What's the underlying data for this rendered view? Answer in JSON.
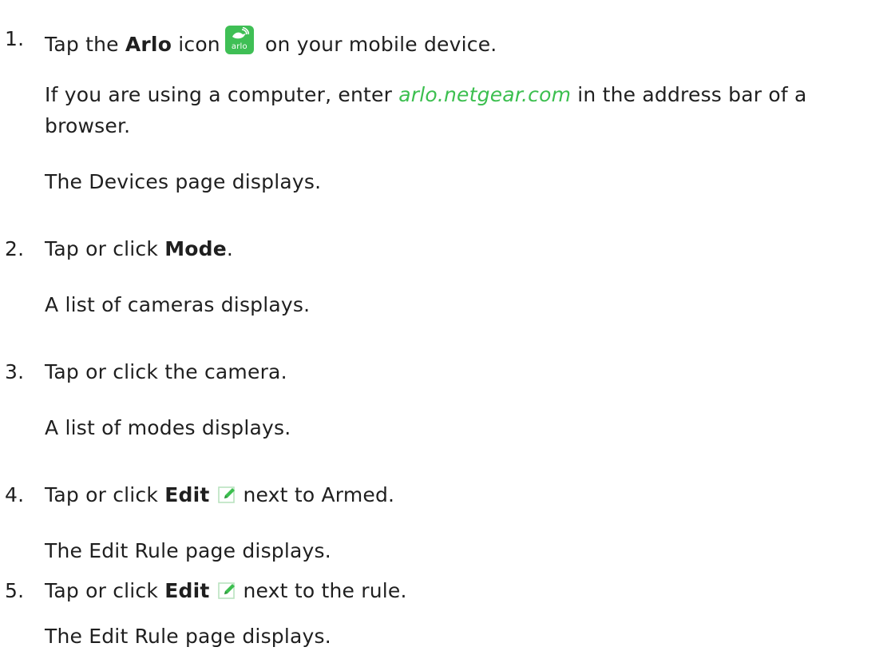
{
  "steps": [
    {
      "number": "1.",
      "parts": {
        "a": "Tap the ",
        "b": "Arlo",
        "c": " icon",
        "d": " on your mobile device."
      },
      "note1": {
        "a": "If you are using a computer, enter ",
        "link": "arlo.netgear.com",
        "b": " in the address bar of a",
        "c": "browser."
      },
      "note2": "The Devices page displays."
    },
    {
      "number": "2.",
      "parts": {
        "a": "Tap or click ",
        "b": "Mode",
        "c": "."
      },
      "note": "A list of cameras displays."
    },
    {
      "number": "3.",
      "text": "Tap or click the camera.",
      "note": "A list of modes displays."
    },
    {
      "number": "4.",
      "parts": {
        "a": "Tap or click ",
        "b": "Edit",
        "c": "next to Armed."
      },
      "note": "The Edit Rule page displays."
    },
    {
      "number": "5.",
      "parts": {
        "a": "Tap or click ",
        "b": "Edit",
        "c": "next to the rule."
      },
      "note": "The Edit Rule page displays."
    }
  ],
  "icons": {
    "arlo_app_icon": "arlo-app-icon",
    "arlo_icon_word": "arlo",
    "edit_icon": "edit-pencil-icon",
    "accent_color": "#3cbf4f"
  }
}
